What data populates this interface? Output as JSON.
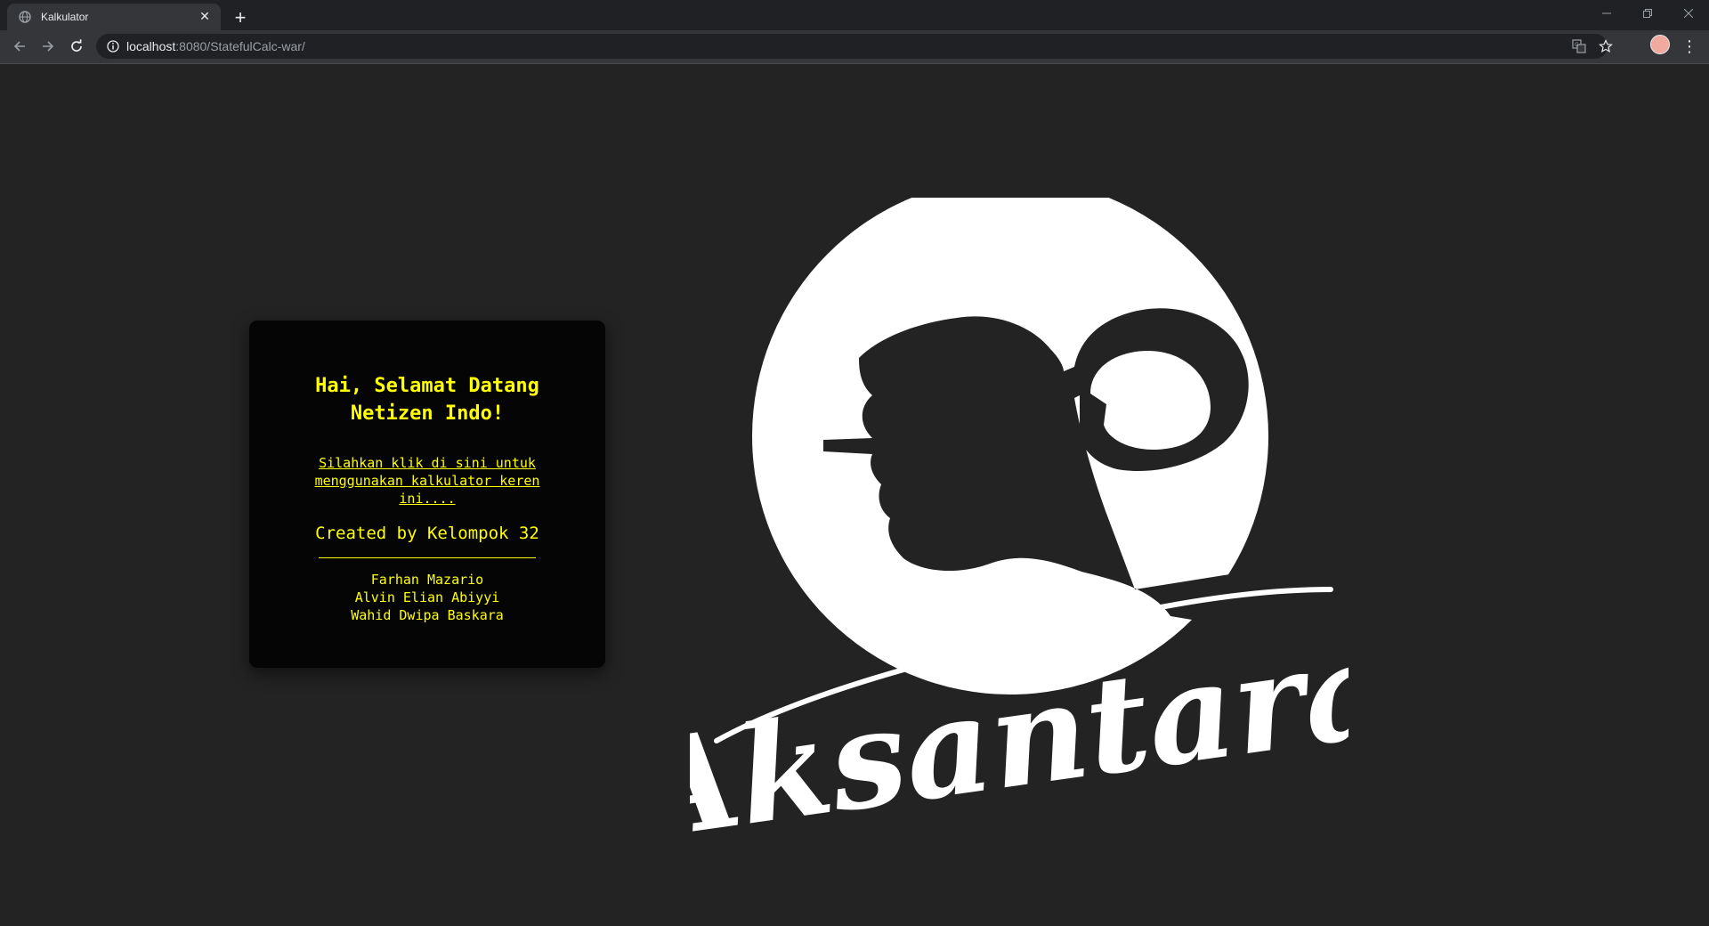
{
  "browser": {
    "tab_title": "Kalkulator",
    "url_host": "localhost",
    "url_rest": ":8080/StatefulCalc-war/"
  },
  "card": {
    "heading": "Hai, Selamat Datang Netizen Indo!",
    "link_text": "Silahkan klik di sini untuk menggunakan kalkulator keren ini....",
    "created_by": "Created by Kelompok 32",
    "members": [
      "Farhan Mazario",
      "Alvin Elian Abiyyi",
      "Wahid Dwipa Baskara"
    ]
  },
  "logo": {
    "wordmark": "Aksantara"
  },
  "colors": {
    "page_bg": "#232323",
    "card_bg": "#050505",
    "accent": "#ffff00"
  }
}
